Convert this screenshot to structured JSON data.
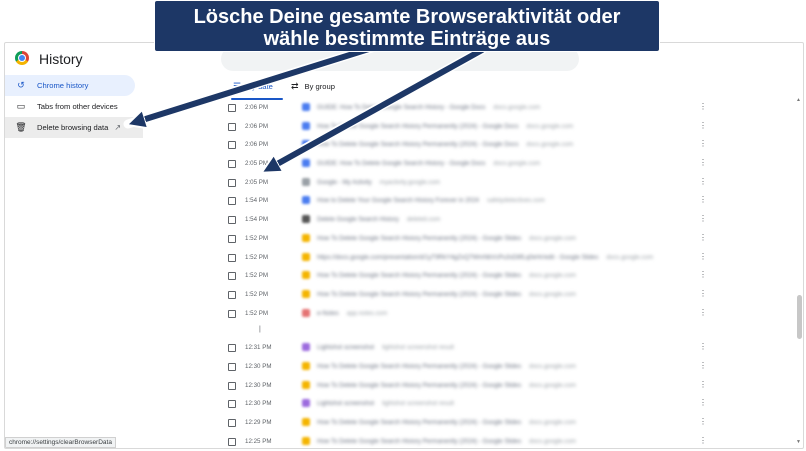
{
  "banner": {
    "line1": "Lösche Deine gesamte Browseraktivität oder",
    "line2": "wähle bestimmte Einträge aus"
  },
  "header": {
    "title": "History"
  },
  "sidebar": {
    "items": [
      {
        "label": "Chrome history",
        "icon": "history-icon"
      },
      {
        "label": "Tabs from other devices",
        "icon": "devices-icon"
      },
      {
        "label": "Delete browsing data",
        "icon": "trash-icon"
      }
    ]
  },
  "tabs": [
    {
      "label": "By date",
      "icon": "list-icon"
    },
    {
      "label": "By group",
      "icon": "group-icon"
    }
  ],
  "history": [
    {
      "time": "2:06 PM",
      "title": "GUIDE: How To Delete Google Search History - Google Docs",
      "domain": "docs.google.com"
    },
    {
      "time": "2:06 PM",
      "title": "How To Delete Google Search History Permanently (2024) - Google Docs",
      "domain": "docs.google.com"
    },
    {
      "time": "2:06 PM",
      "title": "How To Delete Google Search History Permanently (2024) - Google Docs",
      "domain": "docs.google.com"
    },
    {
      "time": "2:05 PM",
      "title": "GUIDE: How To Delete Google Search History - Google Docs",
      "domain": "docs.google.com"
    },
    {
      "time": "2:05 PM",
      "title": "Google - My Activity",
      "domain": "myactivity.google.com"
    },
    {
      "time": "1:54 PM",
      "title": "How to Delete Your Google Search History Forever in 2024",
      "domain": "safetydetectives.com"
    },
    {
      "time": "1:54 PM",
      "title": "Delete Google Search History",
      "domain": "deleteit.com"
    },
    {
      "time": "1:52 PM",
      "title": "How To Delete Google Search History Permanently (2024) - Google Slides",
      "domain": "docs.google.com"
    },
    {
      "time": "1:52 PM",
      "title": "https://docs.google.com/presentation/d/1yT9RkY4gZxQ7WmNbVcPu3sD8fLq0eHr/edit - Google Slides",
      "domain": "docs.google.com"
    },
    {
      "time": "1:52 PM",
      "title": "How To Delete Google Search History Permanently (2024) - Google Slides",
      "domain": "docs.google.com"
    },
    {
      "time": "1:52 PM",
      "title": "How To Delete Google Search History Permanently (2024) - Google Slides",
      "domain": "docs.google.com"
    },
    {
      "time": "1:52 PM",
      "title": "e-Notes",
      "domain": "app.notes.com"
    },
    {
      "time": "12:31 PM",
      "title": "Lightshot screenshot",
      "domain": "lightshot screenshot result"
    },
    {
      "time": "12:30 PM",
      "title": "How To Delete Google Search History Permanently (2024) - Google Slides",
      "domain": "docs.google.com"
    },
    {
      "time": "12:30 PM",
      "title": "How To Delete Google Search History Permanently (2024) - Google Slides",
      "domain": "docs.google.com"
    },
    {
      "time": "12:30 PM",
      "title": "Lightshot screenshot",
      "domain": "lightshot screenshot result"
    },
    {
      "time": "12:29 PM",
      "title": "How To Delete Google Search History Permanently (2024) - Google Slides",
      "domain": "docs.google.com"
    },
    {
      "time": "12:25 PM",
      "title": "How To Delete Google Search History Permanently (2024) - Google Slides",
      "domain": "docs.google.com"
    }
  ],
  "status_url": "chrome://settings/clearBrowserData",
  "colors": {
    "banner": "#1d3766",
    "accent": "#1a57c7",
    "active_bg": "#e8f0fe"
  }
}
